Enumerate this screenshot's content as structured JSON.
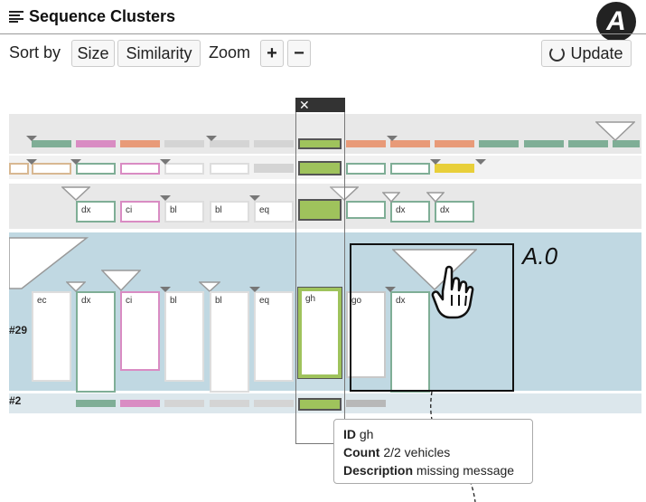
{
  "panel": {
    "title": "Sequence Clusters",
    "badge": "A"
  },
  "toolbar": {
    "sort_by_label": "Sort by",
    "size_label": "Size",
    "similarity_label": "Similarity",
    "zoom_label": "Zoom",
    "zoom_in_label": "+",
    "zoom_out_label": "−",
    "update_label": "Update"
  },
  "column_close_label": "✕",
  "annotation_label": "A.0",
  "cluster_rows": [
    {
      "label": ""
    },
    {
      "label": ""
    },
    {
      "label": ""
    },
    {
      "label": "#29"
    },
    {
      "label": "#2"
    }
  ],
  "row3_boxes": [
    "dx",
    "ci",
    "bl",
    "bl",
    "eq",
    "",
    "",
    "dx",
    "dx"
  ],
  "row4_boxes": [
    "ec",
    "dx",
    "ci",
    "bl",
    "bl",
    "eq",
    "gh",
    "go",
    "dx"
  ],
  "tooltip": {
    "id_key": "ID",
    "id_value": "gh",
    "count_key": "Count",
    "count_value": "2/2 vehicles",
    "description_key": "Description",
    "description_value": "missing message"
  },
  "colors": {
    "green": "#7fae96",
    "pink": "#d98cc3",
    "orange": "#e89a78",
    "grey": "#d4d4d4",
    "tan": "#d8b892",
    "yellow": "#e8cf3a",
    "lime": "#9fc35c",
    "selected_row_bg": "#c0d8e2"
  }
}
